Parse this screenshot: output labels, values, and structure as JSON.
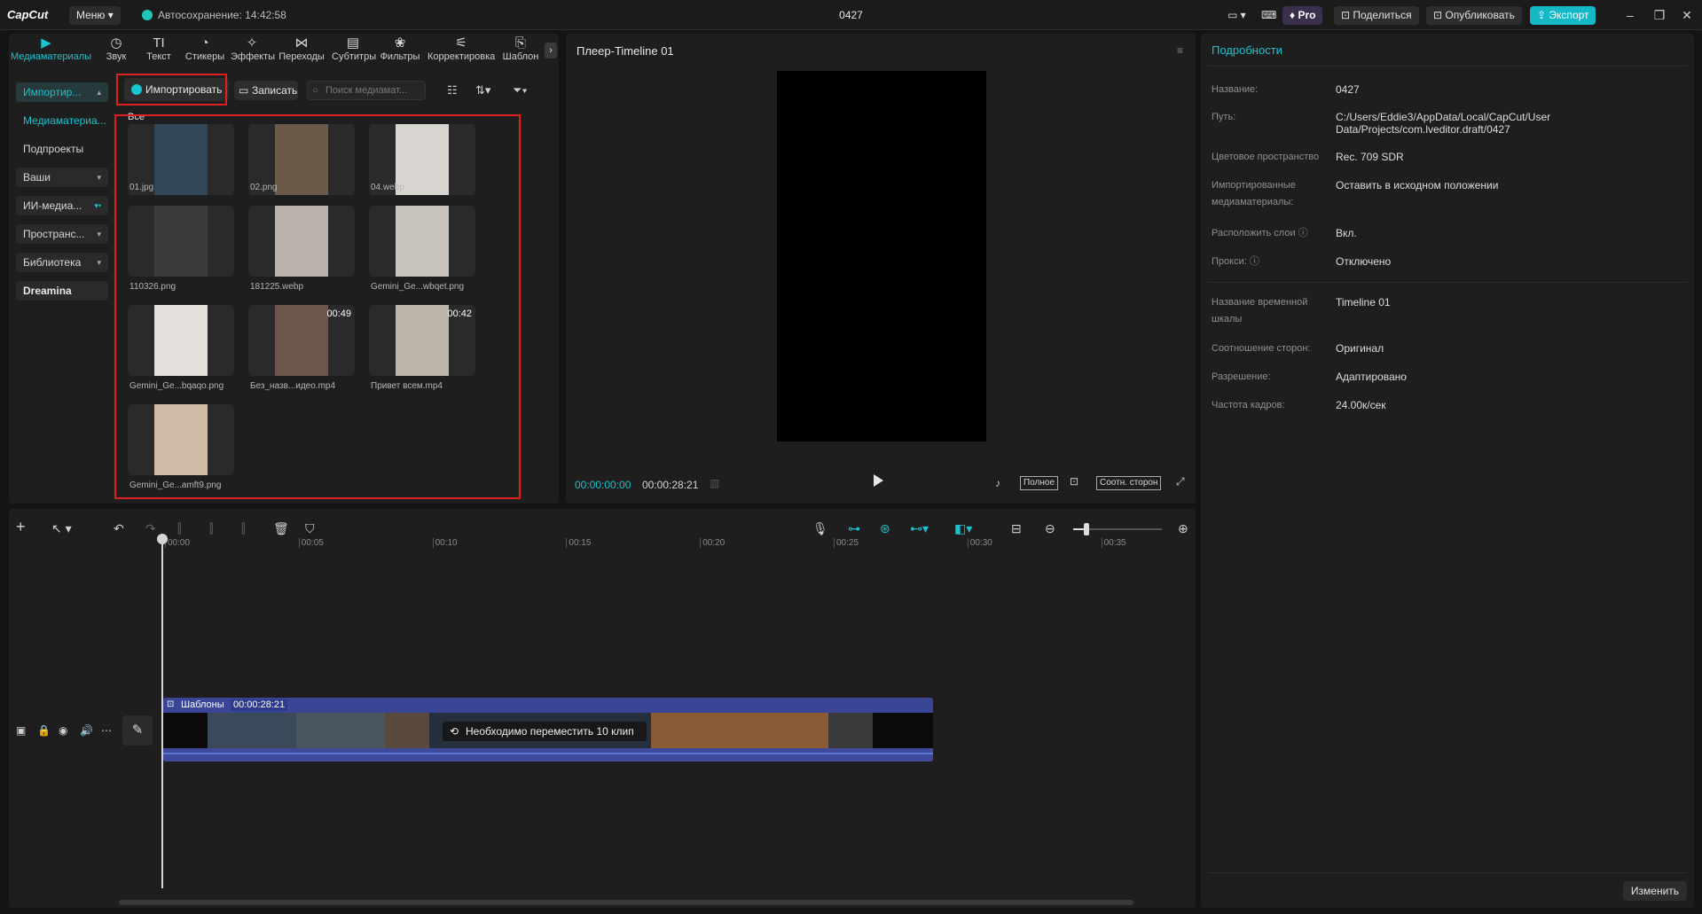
{
  "titlebar": {
    "logo": "CapCut",
    "menu": "Меню",
    "autosave": "Автосохранение: 14:42:58",
    "project": "0427",
    "pro": "Pro",
    "share": "Поделиться",
    "publish": "Опубликовать",
    "export": "Экспорт"
  },
  "categories": [
    {
      "label": "Медиаматериалы",
      "icon": "media-icon"
    },
    {
      "label": "Звук",
      "icon": "audio-icon"
    },
    {
      "label": "Текст",
      "icon": "text-icon"
    },
    {
      "label": "Стикеры",
      "icon": "sticker-icon"
    },
    {
      "label": "Эффекты",
      "icon": "effects-icon"
    },
    {
      "label": "Переходы",
      "icon": "transitions-icon"
    },
    {
      "label": "Субтитры",
      "icon": "subtitles-icon"
    },
    {
      "label": "Фильтры",
      "icon": "filters-icon"
    },
    {
      "label": "Корректировка",
      "icon": "adjust-icon"
    },
    {
      "label": "Шаблон",
      "icon": "template-icon"
    }
  ],
  "nav": [
    {
      "label": "Импортир..."
    },
    {
      "label": "Медиаматериа..."
    },
    {
      "label": "Подпроекты"
    },
    {
      "label": "Ваши"
    },
    {
      "label": "ИИ-медиа..."
    },
    {
      "label": "Пространс..."
    },
    {
      "label": "Библиотека"
    },
    {
      "label": "Dreamina"
    }
  ],
  "media_toolbar": {
    "import": "Импортировать",
    "record": "Записать",
    "search_placeholder": "Поиск медиамат..."
  },
  "media": {
    "section_label": "Все",
    "items": [
      {
        "name": "01.jpg",
        "duration": "",
        "color": "#33475a"
      },
      {
        "name": "02.png",
        "duration": "",
        "color": "#6b5a4a"
      },
      {
        "name": "04.webp",
        "duration": "",
        "color": "#d9d6d2"
      },
      {
        "name": "110326.png",
        "duration": "",
        "color": "#3b3b3b"
      },
      {
        "name": "181225.webp",
        "duration": "",
        "color": "#b9b3ab"
      },
      {
        "name": "Gemini_Ge...wbqet.png",
        "duration": "",
        "color": "#c7c2ba"
      },
      {
        "name": "Gemini_Ge...bqaqo.png",
        "duration": "",
        "color": "#e4e1dc"
      },
      {
        "name": "Без_назв...идео.mp4",
        "duration": "00:49",
        "color": "#6a564a"
      },
      {
        "name": "Привет всем.mp4",
        "duration": "00:42",
        "color": "#bdb6ad"
      },
      {
        "name": "Gemini_Ge...amft9.png",
        "duration": "",
        "color": "#cdbba3"
      }
    ]
  },
  "player": {
    "title": "Плеер-Timeline 01",
    "current": "00:00:00:00",
    "total": "00:00:28:21",
    "full": "Полное",
    "ratio": "Соотн. сторон"
  },
  "details": {
    "title": "Подробности",
    "rows": [
      {
        "label": "Название:",
        "value": "0427"
      },
      {
        "label": "Путь:",
        "value": "C:/Users/Eddie3/AppData/Local/CapCut/User Data/Projects/com.lveditor.draft/0427"
      },
      {
        "label": "Цветовое пространство",
        "value": "Rec. 709 SDR"
      },
      {
        "label": "Импортированные медиаматериалы:",
        "value": "Оставить в исходном положении"
      },
      {
        "label": "Расположить слои",
        "value": "Вкл."
      },
      {
        "label": "Прокси:",
        "value": "Отключено"
      },
      {
        "label": "Название временной шкалы",
        "value": "Timeline 01"
      },
      {
        "label": "Соотношение сторон:",
        "value": "Оригинал"
      },
      {
        "label": "Разрешение:",
        "value": "Адаптировано"
      },
      {
        "label": "Частота кадров:",
        "value": "24.00к/сек"
      }
    ],
    "edit": "Изменить"
  },
  "timeline": {
    "ticks": [
      "00:00",
      "00:05",
      "00:10",
      "00:15",
      "00:20",
      "00:25",
      "00:30",
      "00:35"
    ],
    "clip_label": "Шаблоны",
    "clip_time": "00:00:28:21",
    "clip_message": "Необходимо переместить 10 клип"
  },
  "colors": {
    "accent": "#19c3cf",
    "highlight": "#e02020",
    "clip": "#3f4a9a"
  }
}
